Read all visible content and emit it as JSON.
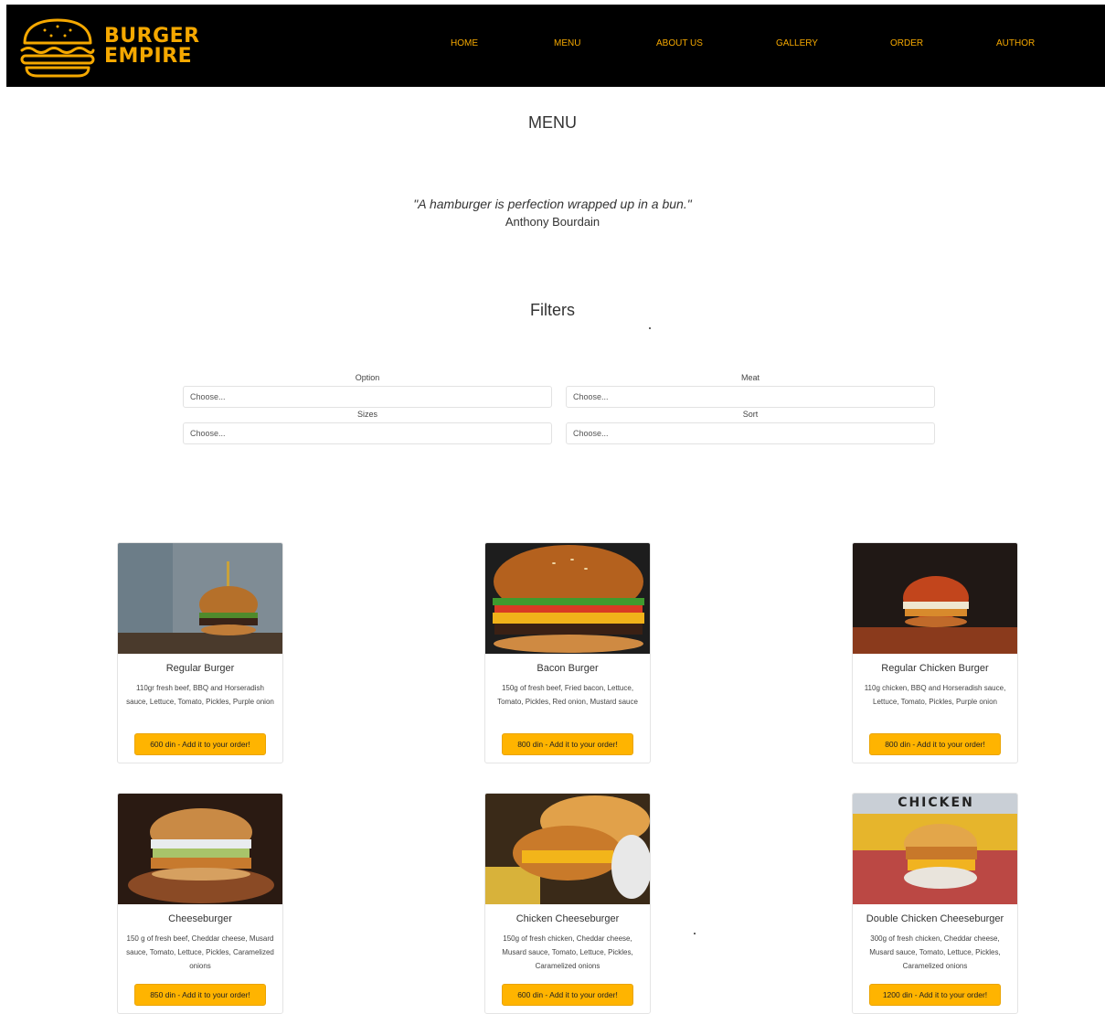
{
  "brand": {
    "line1": "BURGER",
    "line2": "EMPIRE",
    "color": "#f5a800"
  },
  "nav": [
    {
      "label": "HOME"
    },
    {
      "label": "MENU"
    },
    {
      "label": "ABOUT US"
    },
    {
      "label": "GALLERY"
    },
    {
      "label": "ORDER"
    },
    {
      "label": "AUTHOR"
    }
  ],
  "page": {
    "title": "MENU",
    "quote": "\"A hamburger is perfection wrapped up in a bun.\"",
    "quote_author": "Anthony Bourdain",
    "filters_title": "Filters"
  },
  "filters": [
    {
      "label": "Option",
      "value": "Choose..."
    },
    {
      "label": "Meat",
      "value": "Choose..."
    },
    {
      "label": "Sizes",
      "value": "Choose..."
    },
    {
      "label": "Sort",
      "value": "Choose..."
    }
  ],
  "products": [
    {
      "name": "Regular Burger",
      "description": "110gr fresh beef, BBQ and Horseradish sauce, Lettuce, Tomato, Pickles, Purple onion",
      "button": "600 din - Add it to your order!",
      "image_icon": "burger-photo"
    },
    {
      "name": "Bacon Burger",
      "description": "150g of fresh beef, Fried bacon, Lettuce, Tomato, Pickles, Red onion, Mustard sauce",
      "button": "800 din - Add it to your order!",
      "image_icon": "burger-photo"
    },
    {
      "name": "Regular Chicken Burger",
      "description": "110g chicken, BBQ and Horseradish sauce, Lettuce, Tomato, Pickles, Purple onion",
      "button": "800 din - Add it to your order!",
      "image_icon": "burger-photo"
    },
    {
      "name": "Cheeseburger",
      "description": "150 g of fresh beef, Cheddar cheese, Musard sauce, Tomato, Lettuce, Pickles, Caramelized onions",
      "button": "850 din - Add it to your order!",
      "image_icon": "burger-photo"
    },
    {
      "name": "Chicken Cheeseburger",
      "description": "150g of fresh chicken, Cheddar cheese, Musard sauce, Tomato, Lettuce, Pickles, Caramelized onions",
      "button": "600 din - Add it to your order!",
      "image_icon": "burger-photo"
    },
    {
      "name": "Double Chicken Cheeseburger",
      "description": "300g of fresh chicken, Cheddar cheese, Musard sauce, Tomato, Lettuce, Pickles, Caramelized onions",
      "button": "1200 din - Add it to your order!",
      "image_icon": "burger-photo",
      "image_text": "CHICKEN"
    }
  ],
  "colors": {
    "accent": "#ffb400",
    "nav_bg": "#000000"
  }
}
